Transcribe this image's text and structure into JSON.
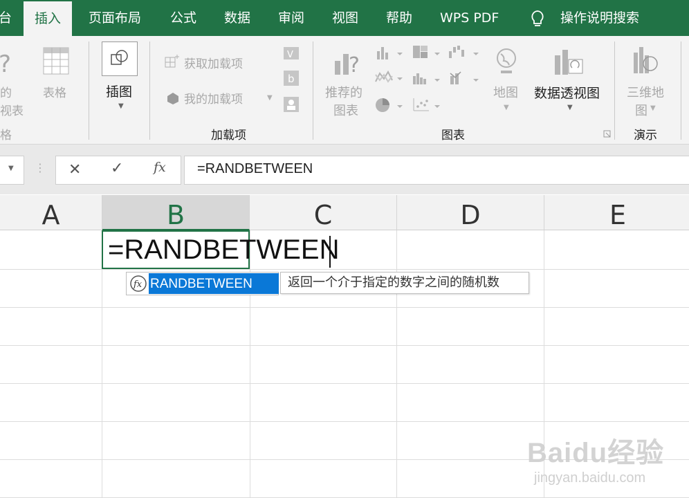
{
  "tabs": [
    {
      "label": "台",
      "active": false
    },
    {
      "label": "插入",
      "active": true
    },
    {
      "label": "页面布局",
      "active": false
    },
    {
      "label": "公式",
      "active": false
    },
    {
      "label": "数据",
      "active": false
    },
    {
      "label": "审阅",
      "active": false
    },
    {
      "label": "视图",
      "active": false
    },
    {
      "label": "帮助",
      "active": false
    },
    {
      "label": "WPS PDF",
      "active": false
    }
  ],
  "tell_me": "操作说明搜索",
  "ribbon": {
    "pivot_partial_1": "的",
    "pivot_partial_2": "视表",
    "table": "表格",
    "group_tables_partial": "格",
    "illustrations": "插图",
    "get_addins": "获取加载项",
    "my_addins": "我的加载项",
    "group_addins": "加载项",
    "recommended_charts_1": "推荐的",
    "recommended_charts_2": "图表",
    "map": "地图",
    "pivot_chart": "数据透视图",
    "group_charts": "图表",
    "map3d_1": "三维地",
    "map3d_2": "图",
    "group_tours": "演示"
  },
  "formula_bar": {
    "cancel": "✕",
    "confirm": "✓",
    "fx": "fx",
    "content": "=RANDBETWEEN"
  },
  "columns": [
    "A",
    "B",
    "C",
    "D",
    "E"
  ],
  "selected_column": "B",
  "cell_edit": "=RANDBETWEEN",
  "autocomplete": {
    "item": "RANDBETWEEN",
    "tooltip": "返回一个介于指定的数字之间的随机数"
  },
  "watermark": {
    "line1": "Baidu经验",
    "line2": "jingyan.baidu.com"
  },
  "colors": {
    "brand_green": "#217346",
    "selection_blue": "#0a78d7"
  }
}
